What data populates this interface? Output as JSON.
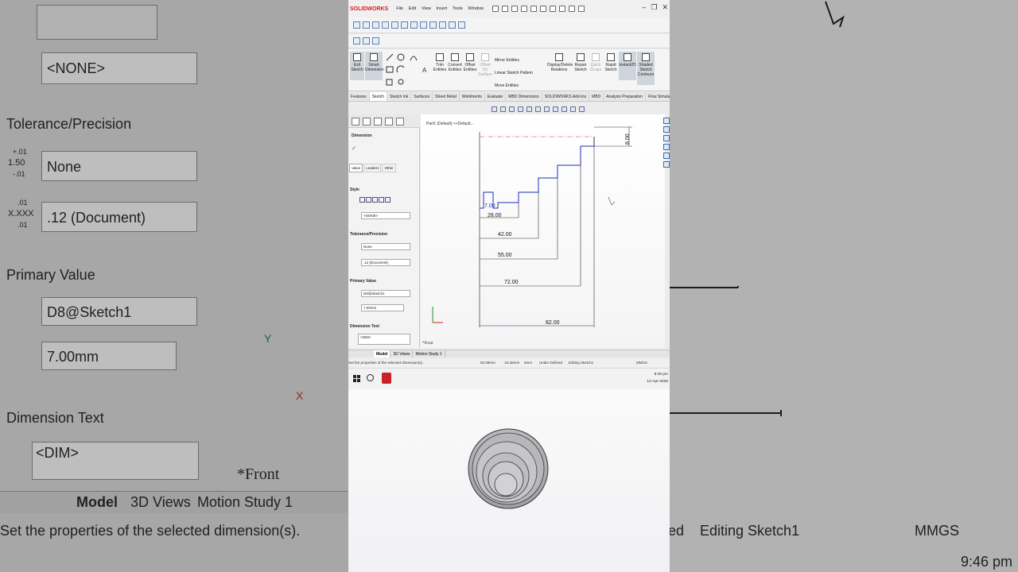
{
  "app": {
    "logo": "SOLIDWORKS",
    "menu": [
      "File",
      "Edit",
      "View",
      "Insert",
      "Tools",
      "Window"
    ],
    "window_controls": [
      "–",
      "❐",
      "✕"
    ]
  },
  "command_manager": {
    "buttons": [
      {
        "label": "Exit Sketch"
      },
      {
        "label": "Smart Dimension"
      },
      {
        "label": "Trim Entities"
      },
      {
        "label": "Convert Entities"
      },
      {
        "label": "Offset Entities"
      },
      {
        "label": "Offset On Surface"
      },
      {
        "label": "Display/Delete Relations"
      },
      {
        "label": "Repair Sketch"
      },
      {
        "label": "Quick Snaps"
      },
      {
        "label": "Rapid Sketch"
      },
      {
        "label": "Instant2D"
      },
      {
        "label": "Shaded Sketch Contours"
      }
    ],
    "list_items": [
      "Mirror Entities",
      "Linear Sketch Pattern",
      "Move Entities"
    ]
  },
  "tabs": [
    "Features",
    "Sketch",
    "Sketch Ink",
    "Surfaces",
    "Sheet Metal",
    "Weldments",
    "Evaluate",
    "MBD Dimensions",
    "SOLIDWORKS Add-Ins",
    "MBD",
    "Analysis Preparation",
    "Flow Simulation"
  ],
  "active_tab": "Sketch",
  "property_manager": {
    "title": "Dimension",
    "subtabs": [
      "Value",
      "Leaders",
      "Other"
    ],
    "style_label": "Style",
    "style_value": "<NONE>",
    "tolerance_label": "Tolerance/Precision",
    "tolerance_value": "None",
    "precision_value": ".12 (Document)",
    "primary_label": "Primary Value",
    "primary_name": "D8@Sketch1",
    "primary_value": "7.00mm",
    "dimtext_label": "Dimension Text",
    "dimtext_value": "<DIM>"
  },
  "tree": {
    "part_label": "Part1 (Default) <<Default..."
  },
  "view_label": "*Front",
  "dimensions": [
    "7.00",
    "28.00",
    "42.00",
    "55.00",
    "72.00",
    "82.00",
    "8.00"
  ],
  "model_tabs": [
    "Model",
    "3D Views",
    "Motion Study 1"
  ],
  "status": {
    "message": "Set the properties of the selected dimension(s).",
    "x": "93.09mm",
    "y": "-23.36mm",
    "z": "0mm",
    "state": "Under Defined",
    "editing": "Editing Sketch1",
    "units": "MMGS"
  },
  "clock": {
    "time": "9:46 pm",
    "date": "12-Apr-2025"
  },
  "backdrop": {
    "tolerance": "Tolerance/Precision",
    "none_style": "<NONE>",
    "none": "None",
    "precision": ".12 (Document)",
    "primary": "Primary Value",
    "name": "D8@Sketch1",
    "value": "7.00mm",
    "dimtext": "Dimension Text",
    "dim": "<DIM>",
    "front": "*Front",
    "model": "Model",
    "views3d": "3D Views",
    "motion": "Motion Study 1",
    "status": "Set the properties of the selected dimension(s).",
    "ed": "ed",
    "editing": "Editing Sketch1",
    "units": "MMGS",
    "time": "9:46 pm",
    "tol_top": "+.01",
    "tol_mid": "1.50",
    "tol_bot": "-.01",
    "prec_top": ".01",
    "prec_mid": "X.XXX",
    "prec_bot": ".01",
    "axis_y": "Y",
    "axis_x": "X"
  }
}
